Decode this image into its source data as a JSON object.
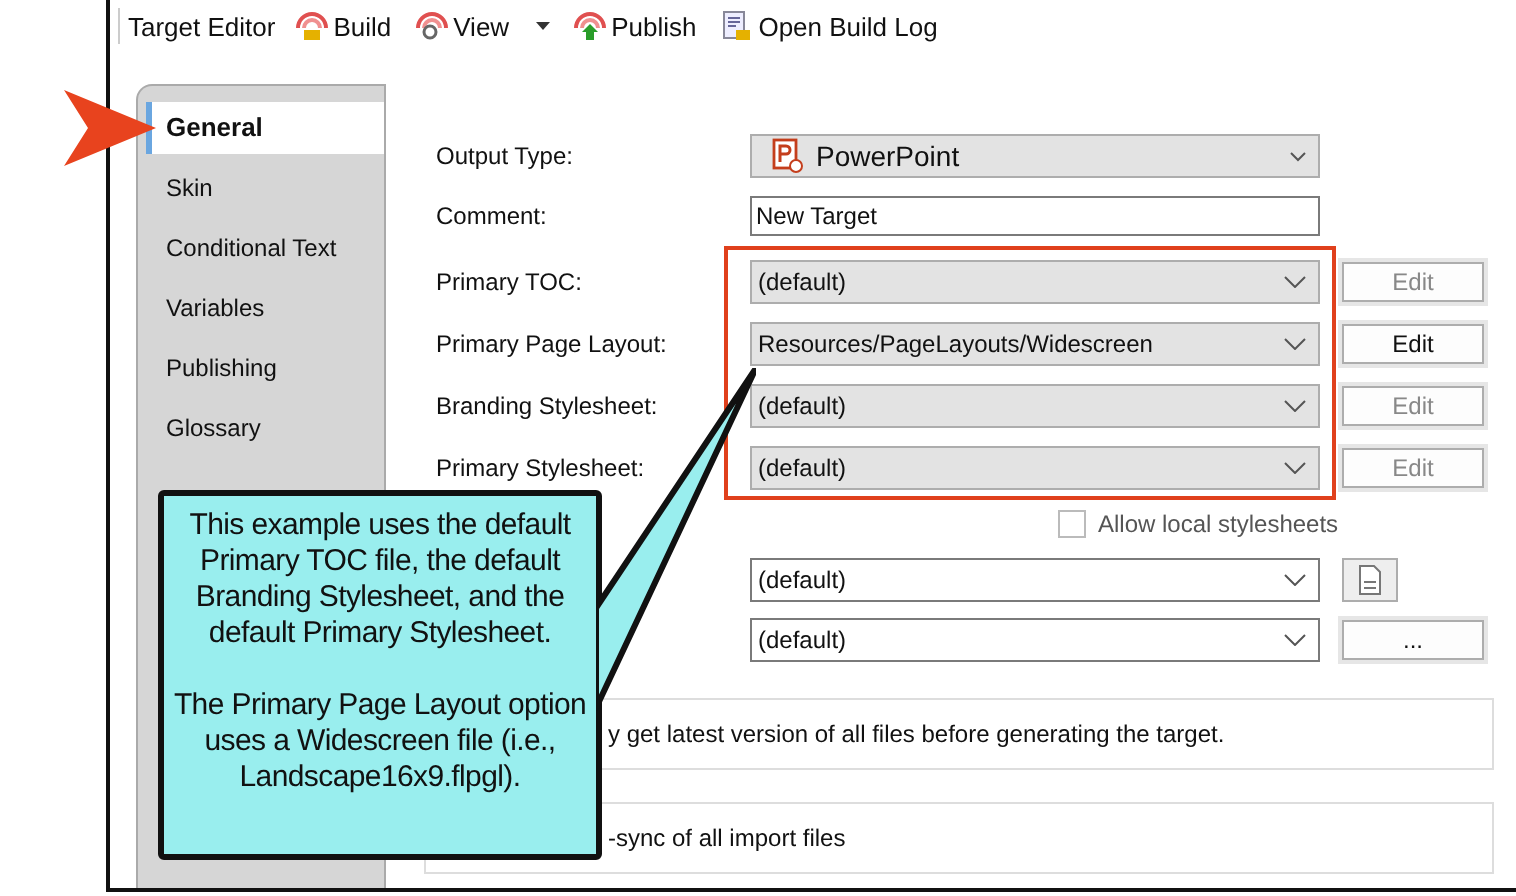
{
  "toolbar": {
    "title": "Target Editor",
    "buttons": [
      {
        "label": "Build",
        "dropdown": false
      },
      {
        "label": "View",
        "dropdown": true
      },
      {
        "label": "Publish",
        "dropdown": false
      },
      {
        "label": "Open Build Log",
        "dropdown": false
      }
    ]
  },
  "sidebar": {
    "items": [
      {
        "label": "General",
        "selected": true
      },
      {
        "label": "Skin",
        "selected": false
      },
      {
        "label": "Conditional Text",
        "selected": false
      },
      {
        "label": "Variables",
        "selected": false
      },
      {
        "label": "Publishing",
        "selected": false
      },
      {
        "label": "Glossary",
        "selected": false
      }
    ]
  },
  "fields": [
    {
      "kind": "dropdown",
      "label": "Output Type:",
      "value": "PowerPoint"
    },
    {
      "kind": "text",
      "label": "Comment:",
      "value": "New Target"
    }
  ],
  "highlighted_group": {
    "highlighted": true,
    "fields": [
      {
        "label": "Primary TOC:",
        "value": "(default)",
        "button": {
          "label": "Edit",
          "disabled": true
        }
      },
      {
        "label": "Primary Page Layout:",
        "value": "Resources/PageLayouts/Widescreen",
        "button": {
          "label": "Edit",
          "disabled": false
        }
      },
      {
        "label": "Branding Stylesheet:",
        "value": "(default)",
        "button": {
          "label": "Edit",
          "disabled": true
        }
      },
      {
        "label": "Primary Stylesheet:",
        "value": "(default)",
        "button": {
          "label": "Edit",
          "disabled": true
        }
      }
    ]
  },
  "checkbox": {
    "label": "Allow local stylesheets",
    "checked": false
  },
  "more_fields": [
    {
      "value": "(default)",
      "button": {
        "kind": "icon"
      }
    },
    {
      "value": "(default)",
      "button": {
        "kind": "text",
        "label": "..."
      }
    }
  ],
  "options": [
    {
      "text": "y get latest version of all files before generating the target."
    },
    {
      "text": "-sync of all import files"
    }
  ],
  "callout": {
    "paragraphs": [
      "This example uses the default Primary TOC file, the default Branding Stylesheet, and the default Primary Stylesheet.",
      "The Primary Page Layout option uses a Widescreen file (i.e., Landscape16x9.flpgl)."
    ]
  }
}
